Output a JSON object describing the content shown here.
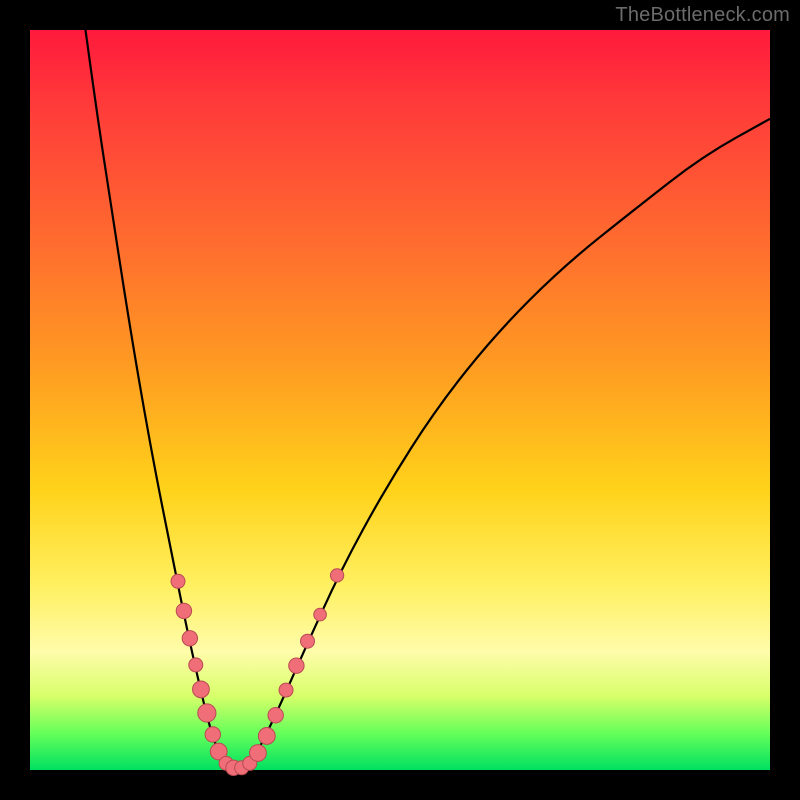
{
  "watermark": "TheBottleneck.com",
  "colors": {
    "dot_fill": "#ef6e78",
    "dot_stroke": "#b94a52",
    "curve": "#000000"
  },
  "chart_data": {
    "type": "line",
    "title": "",
    "xlabel": "",
    "ylabel": "",
    "xlim": [
      0,
      100
    ],
    "ylim": [
      0,
      100
    ],
    "note": "V-shaped bottleneck curve on a red-to-green vertical gradient. Minimum bottleneck (~0) occurs around x≈25–30. Left branch descends from ~100 at x≈7.5 to ~0 at x≈25; right branch rises from ~0 at x≈30 toward ~88 at x=100. Salmon dots cluster near the valley on both branches (y roughly 0–27). Values estimated from pixels; no axis ticks shown.",
    "series": [
      {
        "name": "left_branch",
        "x": [
          7.5,
          9,
          11,
          13,
          15,
          17,
          19,
          21,
          23,
          24.5,
          26
        ],
        "y": [
          100,
          89,
          76,
          63,
          51,
          40,
          30,
          20,
          11,
          5,
          1
        ]
      },
      {
        "name": "valley",
        "x": [
          26,
          27,
          28,
          29,
          30
        ],
        "y": [
          1,
          0.3,
          0.2,
          0.4,
          1
        ]
      },
      {
        "name": "right_branch",
        "x": [
          30,
          33,
          37,
          42,
          48,
          55,
          63,
          72,
          82,
          91,
          100
        ],
        "y": [
          1,
          7,
          16,
          27,
          38,
          49,
          59,
          68,
          76,
          83,
          88
        ]
      }
    ],
    "points": [
      {
        "branch": "left",
        "x": 20.0,
        "y": 25.5,
        "r": 1.0
      },
      {
        "branch": "left",
        "x": 20.8,
        "y": 21.5,
        "r": 1.1
      },
      {
        "branch": "left",
        "x": 21.6,
        "y": 17.8,
        "r": 1.1
      },
      {
        "branch": "left",
        "x": 22.4,
        "y": 14.2,
        "r": 1.0
      },
      {
        "branch": "left",
        "x": 23.1,
        "y": 10.9,
        "r": 1.2
      },
      {
        "branch": "left",
        "x": 23.9,
        "y": 7.7,
        "r": 1.3
      },
      {
        "branch": "left",
        "x": 24.7,
        "y": 4.8,
        "r": 1.1
      },
      {
        "branch": "left",
        "x": 25.5,
        "y": 2.5,
        "r": 1.2
      },
      {
        "branch": "left",
        "x": 26.5,
        "y": 0.9,
        "r": 1.0
      },
      {
        "branch": "valley",
        "x": 27.5,
        "y": 0.3,
        "r": 1.1
      },
      {
        "branch": "valley",
        "x": 28.6,
        "y": 0.3,
        "r": 1.0
      },
      {
        "branch": "right",
        "x": 29.7,
        "y": 0.9,
        "r": 1.0
      },
      {
        "branch": "right",
        "x": 30.8,
        "y": 2.3,
        "r": 1.2
      },
      {
        "branch": "right",
        "x": 32.0,
        "y": 4.6,
        "r": 1.2
      },
      {
        "branch": "right",
        "x": 33.2,
        "y": 7.4,
        "r": 1.1
      },
      {
        "branch": "right",
        "x": 34.6,
        "y": 10.8,
        "r": 1.0
      },
      {
        "branch": "right",
        "x": 36.0,
        "y": 14.1,
        "r": 1.1
      },
      {
        "branch": "right",
        "x": 37.5,
        "y": 17.4,
        "r": 1.0
      },
      {
        "branch": "right",
        "x": 39.2,
        "y": 21.0,
        "r": 0.9
      },
      {
        "branch": "right",
        "x": 41.5,
        "y": 26.3,
        "r": 0.95
      }
    ]
  }
}
